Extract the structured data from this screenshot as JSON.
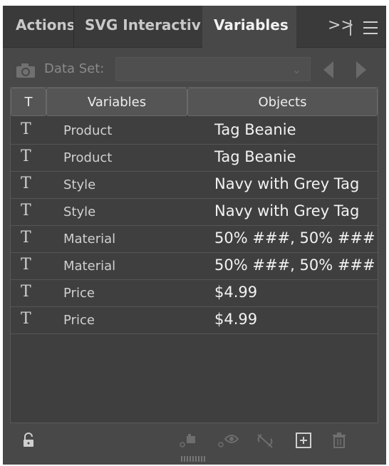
{
  "tabs": [
    {
      "label": "Actions"
    },
    {
      "label": "SVG Interactivity"
    },
    {
      "label": "Variables"
    }
  ],
  "controls": {
    "more": ">>"
  },
  "dataset": {
    "label": "Data Set:",
    "value": ""
  },
  "columns": {
    "type": "T",
    "variables": "Variables",
    "objects": "Objects"
  },
  "rows": [
    {
      "type": "T",
      "variable": "Product",
      "object": "Tag Beanie"
    },
    {
      "type": "T",
      "variable": "Product",
      "object": "Tag Beanie"
    },
    {
      "type": "T",
      "variable": "Style",
      "object": "Navy with Grey Tag"
    },
    {
      "type": "T",
      "variable": "Style",
      "object": "Navy with Grey Tag"
    },
    {
      "type": "T",
      "variable": "Material",
      "object": "50% ###, 50% ###"
    },
    {
      "type": "T",
      "variable": "Material",
      "object": "50% ###, 50% ###"
    },
    {
      "type": "T",
      "variable": "Price",
      "object": "$4.99"
    },
    {
      "type": "T",
      "variable": "Price",
      "object": "$4.99"
    }
  ],
  "footer_icons": [
    "unlock-icon",
    "make-object-dynamic-icon",
    "make-visibility-dynamic-icon",
    "unbind-icon",
    "new-variable-icon",
    "delete-variable-icon"
  ]
}
